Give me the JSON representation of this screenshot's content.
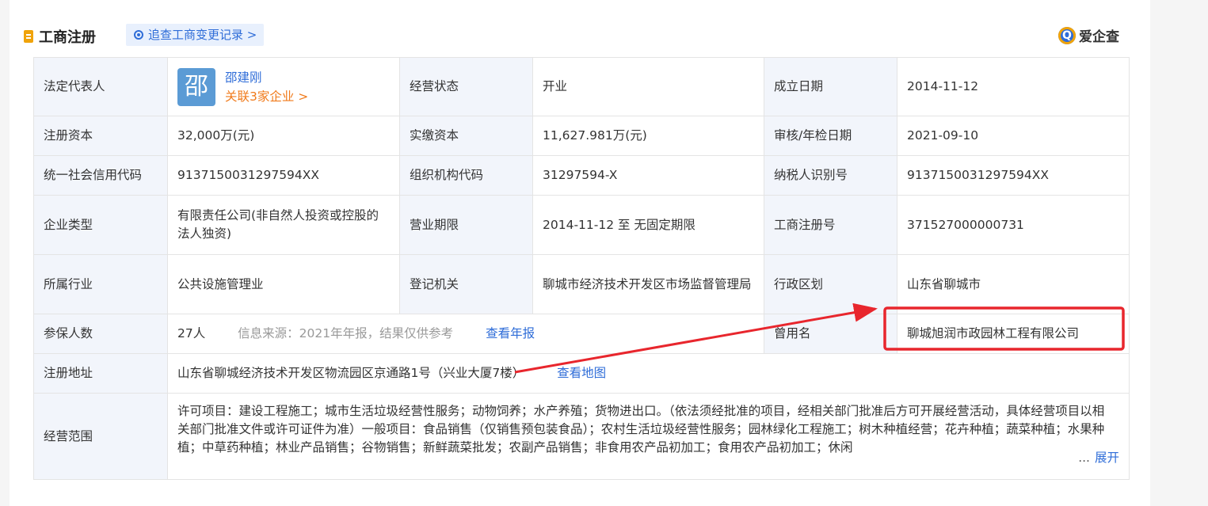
{
  "header": {
    "title": "工商注册",
    "change_link": "追查工商变更记录 >",
    "brand_logo_char": "Q",
    "brand_name": "爱企查"
  },
  "rows": {
    "legal_rep": {
      "label": "法定代表人",
      "avatar_char": "邵",
      "name": "邵建刚",
      "related": "关联3家企业 >"
    },
    "status": {
      "label": "经营状态",
      "value": "开业"
    },
    "founded": {
      "label": "成立日期",
      "value": "2014-11-12"
    },
    "reg_capital": {
      "label": "注册资本",
      "value": "32,000万(元)"
    },
    "paid_capital": {
      "label": "实缴资本",
      "value": "11,627.981万(元)"
    },
    "audit_date": {
      "label": "审核/年检日期",
      "value": "2021-09-10"
    },
    "credit_code": {
      "label": "统一社会信用代码",
      "value": "9137150031297594XX"
    },
    "org_code": {
      "label": "组织机构代码",
      "value": "31297594-X"
    },
    "taxpayer_id": {
      "label": "纳税人识别号",
      "value": "9137150031297594XX"
    },
    "company_type": {
      "label": "企业类型",
      "value": "有限责任公司(非自然人投资或控股的法人独资)"
    },
    "business_term": {
      "label": "营业期限",
      "value": "2014-11-12 至 无固定期限"
    },
    "reg_number": {
      "label": "工商注册号",
      "value": "371527000000731"
    },
    "industry": {
      "label": "所属行业",
      "value": "公共设施管理业"
    },
    "authority": {
      "label": "登记机关",
      "value": "聊城市经济技术开发区市场监督管理局"
    },
    "region": {
      "label": "行政区划",
      "value": "山东省聊城市"
    },
    "insured": {
      "label": "参保人数",
      "value": "27人",
      "source": "信息来源：2021年年报，结果仅供参考",
      "report_link": "查看年报"
    },
    "former_name": {
      "label": "曾用名",
      "value": "聊城旭润市政园林工程有限公司"
    },
    "address": {
      "label": "注册地址",
      "value": "山东省聊城经济技术开发区物流园区京通路1号（兴业大厦7楼）",
      "map_link": "查看地图"
    },
    "scope": {
      "label": "经营范围",
      "value": "许可项目：建设工程施工；城市生活垃圾经营性服务；动物饲养；水产养殖；货物进出口。（依法须经批准的项目，经相关部门批准后方可开展经营活动，具体经营项目以相关部门批准文件或许可证件为准）一般项目：食品销售（仅销售预包装食品）；农村生活垃圾经营性服务；园林绿化工程施工；树木种植经营；花卉种植；蔬菜种植；水果种植；中草药种植；林业产品销售；谷物销售；新鲜蔬菜批发；农副产品销售；非食用农产品初加工；食用农产品初加工；休闲",
      "ellipsis": "...",
      "expand": "展开"
    }
  },
  "annotation": {
    "color": "#e8262d"
  },
  "colors": {
    "accent": "#2f6dd8",
    "orange": "#f07a1a",
    "label_bg": "#f2f5fb"
  }
}
